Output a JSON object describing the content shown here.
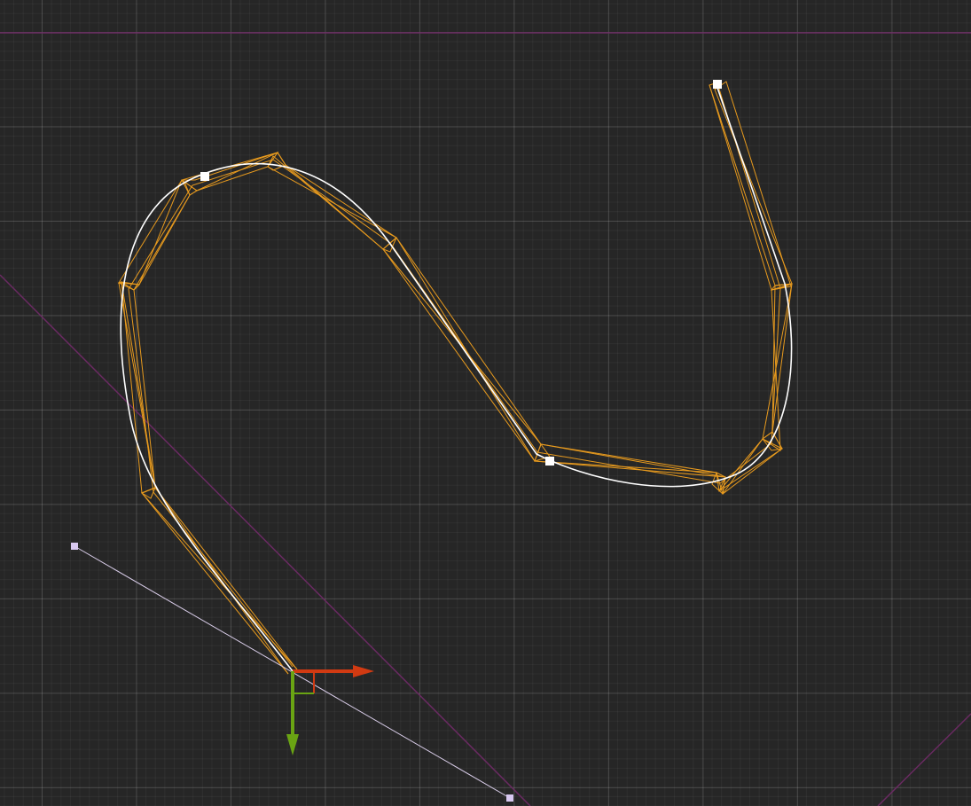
{
  "viewport": {
    "background": "#262626",
    "grid": true
  },
  "colors": {
    "wireframe": "#e79a1e",
    "curve": "#ffffff",
    "guide_line": "#6a2a62",
    "handle_line": "#d8cce8",
    "control_point": "#ffffff",
    "handle_point": "#d8c8f0",
    "gizmo_x_axis": "#d13a12",
    "gizmo_y_axis": "#6aa413"
  },
  "gizmo": {
    "x_axis_icon": "arrow-right-icon",
    "y_axis_icon": "arrow-down-icon"
  }
}
